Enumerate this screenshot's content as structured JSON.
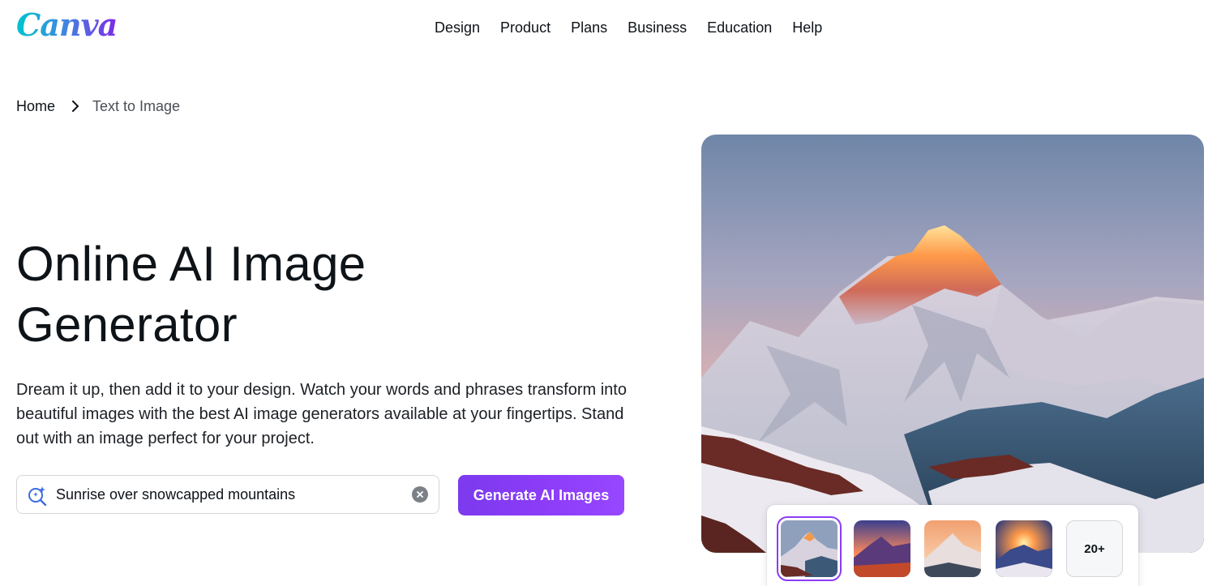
{
  "brand": {
    "logo_text": "Canva"
  },
  "nav": {
    "items": [
      {
        "label": "Design"
      },
      {
        "label": "Product"
      },
      {
        "label": "Plans"
      },
      {
        "label": "Business"
      },
      {
        "label": "Education"
      },
      {
        "label": "Help"
      }
    ]
  },
  "breadcrumb": {
    "home": "Home",
    "current": "Text to Image",
    "separator_icon": "chevron-right-icon"
  },
  "hero": {
    "title_line1": "Online AI Image",
    "title_line2": "Generator",
    "description": "Dream it up, then add it to your design. Watch your words and phrases transform into beautiful images with the best AI image generators available at your fingertips. Stand out with an image perfect for your project."
  },
  "search": {
    "value": "Sunrise over snowcapped mountains",
    "icon": "magic-search-icon",
    "clear_icon": "clear-icon"
  },
  "cta": {
    "label": "Generate AI Images"
  },
  "gallery": {
    "thumbnails": [
      {
        "name": "thumb-1",
        "selected": true
      },
      {
        "name": "thumb-2",
        "selected": false
      },
      {
        "name": "thumb-3",
        "selected": false
      },
      {
        "name": "thumb-4",
        "selected": false
      }
    ],
    "more_label": "20+"
  },
  "colors": {
    "accent": "#8b3cf7",
    "text": "#0e1318",
    "logo_gradient": [
      "#00c4cc",
      "#7d2ae8"
    ]
  }
}
